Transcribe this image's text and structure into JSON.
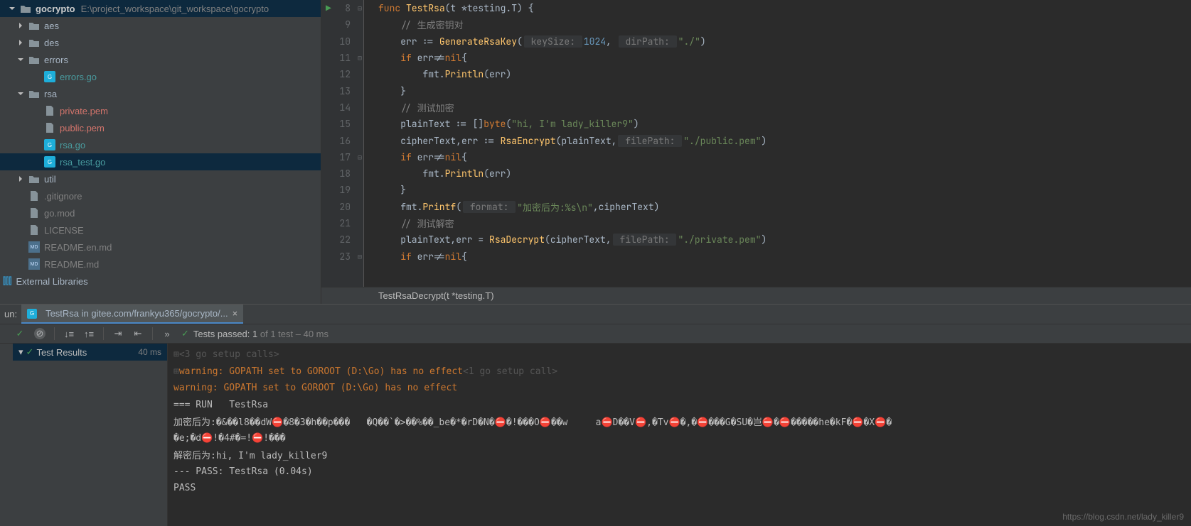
{
  "project": {
    "name": "gocrypto",
    "path": "E:\\project_workspace\\git_workspace\\gocrypto",
    "tree": [
      {
        "label": "aes",
        "type": "folder",
        "indent": 1,
        "arrow": "right"
      },
      {
        "label": "des",
        "type": "folder",
        "indent": 1,
        "arrow": "right"
      },
      {
        "label": "errors",
        "type": "folder",
        "indent": 1,
        "arrow": "down"
      },
      {
        "label": "errors.go",
        "type": "go",
        "indent": 2,
        "color": "teal"
      },
      {
        "label": "rsa",
        "type": "folder",
        "indent": 1,
        "arrow": "down"
      },
      {
        "label": "private.pem",
        "type": "file",
        "indent": 2,
        "color": "red"
      },
      {
        "label": "public.pem",
        "type": "file",
        "indent": 2,
        "color": "red"
      },
      {
        "label": "rsa.go",
        "type": "go",
        "indent": 2,
        "color": "teal"
      },
      {
        "label": "rsa_test.go",
        "type": "go",
        "indent": 2,
        "color": "teal",
        "selected": true
      },
      {
        "label": "util",
        "type": "folder",
        "indent": 1,
        "arrow": "right"
      },
      {
        "label": ".gitignore",
        "type": "file",
        "indent": 1,
        "color": "gray"
      },
      {
        "label": "go.mod",
        "type": "file",
        "indent": 1,
        "color": "gray"
      },
      {
        "label": "LICENSE",
        "type": "file",
        "indent": 1,
        "color": "gray"
      },
      {
        "label": "README.en.md",
        "type": "md",
        "indent": 1,
        "color": "gray"
      },
      {
        "label": "README.md",
        "type": "md",
        "indent": 1,
        "color": "gray"
      }
    ],
    "external_libraries": "External Libraries"
  },
  "editor": {
    "breadcrumb": "TestRsaDecrypt(t *testing.T)",
    "lines": [
      {
        "n": 8,
        "run": true,
        "fold": "open",
        "tokens": [
          [
            "kw",
            "func "
          ],
          [
            "fn",
            "TestRsa"
          ],
          [
            "ident",
            "(t *testing.T) {"
          ]
        ]
      },
      {
        "n": 9,
        "tokens": [
          [
            "ident",
            "    "
          ],
          [
            "cmt",
            "// 生成密钥对"
          ]
        ]
      },
      {
        "n": 10,
        "tokens": [
          [
            "ident",
            "    err := "
          ],
          [
            "fn",
            "GenerateRsaKey"
          ],
          [
            "ident",
            "("
          ],
          [
            "hint",
            " keySize: "
          ],
          [
            "num",
            "1024"
          ],
          [
            "ident",
            ", "
          ],
          [
            "hint",
            " dirPath: "
          ],
          [
            "str",
            "\"./\""
          ],
          [
            "ident",
            ")"
          ]
        ]
      },
      {
        "n": 11,
        "fold": "close",
        "tokens": [
          [
            "ident",
            "    "
          ],
          [
            "kw",
            "if "
          ],
          [
            "ident",
            "err!="
          ],
          [
            "kw",
            "nil"
          ],
          [
            "ident",
            "{"
          ]
        ]
      },
      {
        "n": 12,
        "tokens": [
          [
            "ident",
            "        fmt."
          ],
          [
            "fn",
            "Println"
          ],
          [
            "ident",
            "(err)"
          ]
        ]
      },
      {
        "n": 13,
        "tokens": [
          [
            "ident",
            "    }"
          ]
        ]
      },
      {
        "n": 14,
        "tokens": [
          [
            "ident",
            "    "
          ],
          [
            "cmt",
            "// 测试加密"
          ]
        ]
      },
      {
        "n": 15,
        "tokens": [
          [
            "ident",
            "    plainText := []"
          ],
          [
            "typ",
            "byte"
          ],
          [
            "ident",
            "("
          ],
          [
            "str",
            "\"hi, I'm lady_killer9\""
          ],
          [
            "ident",
            ")"
          ]
        ]
      },
      {
        "n": 16,
        "tokens": [
          [
            "ident",
            "    cipherText,err := "
          ],
          [
            "fn",
            "RsaEncrypt"
          ],
          [
            "ident",
            "(plainText,"
          ],
          [
            "hint",
            " filePath: "
          ],
          [
            "str",
            "\"./public.pem\""
          ],
          [
            "ident",
            ")"
          ]
        ]
      },
      {
        "n": 17,
        "fold": "close",
        "tokens": [
          [
            "ident",
            "    "
          ],
          [
            "kw",
            "if "
          ],
          [
            "ident",
            "err!="
          ],
          [
            "kw",
            "nil"
          ],
          [
            "ident",
            "{"
          ]
        ]
      },
      {
        "n": 18,
        "tokens": [
          [
            "ident",
            "        fmt."
          ],
          [
            "fn",
            "Println"
          ],
          [
            "ident",
            "(err)"
          ]
        ]
      },
      {
        "n": 19,
        "tokens": [
          [
            "ident",
            "    }"
          ]
        ]
      },
      {
        "n": 20,
        "tokens": [
          [
            "ident",
            "    fmt."
          ],
          [
            "fn",
            "Printf"
          ],
          [
            "ident",
            "("
          ],
          [
            "hint",
            " format: "
          ],
          [
            "str",
            "\"加密后为:%s\\n\""
          ],
          [
            "ident",
            ",cipherText)"
          ]
        ]
      },
      {
        "n": 21,
        "tokens": [
          [
            "ident",
            "    "
          ],
          [
            "cmt",
            "// 测试解密"
          ]
        ]
      },
      {
        "n": 22,
        "tokens": [
          [
            "ident",
            "    plainText,err = "
          ],
          [
            "fn",
            "RsaDecrypt"
          ],
          [
            "ident",
            "(cipherText,"
          ],
          [
            "hint",
            " filePath: "
          ],
          [
            "str",
            "\"./private.pem\""
          ],
          [
            "ident",
            ")"
          ]
        ]
      },
      {
        "n": 23,
        "fold": "close",
        "tokens": [
          [
            "ident",
            "    "
          ],
          [
            "kw",
            "if "
          ],
          [
            "ident",
            "err!="
          ],
          [
            "kw",
            "nil"
          ],
          [
            "ident",
            "{"
          ]
        ]
      }
    ]
  },
  "run": {
    "panel_label": "un:",
    "tab_title": "TestRsa in gitee.com/frankyu365/gocrypto/...",
    "tests_passed_prefix": "Tests passed:",
    "tests_passed_count": "1",
    "tests_passed_total": "of 1 test – 40 ms",
    "test_results_label": "Test Results",
    "test_results_time": "40 ms",
    "console": [
      {
        "cls": "console-gray",
        "prefix": "⊞",
        "text": "<3 go setup calls>"
      },
      {
        "cls": "console-orange",
        "prefix": "⊞",
        "text": "warning: GOPATH set to GOROOT (D:\\Go) has no effect",
        "suffix": "<1 go setup call>"
      },
      {
        "cls": "console-orange",
        "text": "warning: GOPATH set to GOROOT (D:\\Go) has no effect"
      },
      {
        "cls": "console-white",
        "text": "=== RUN   TestRsa"
      },
      {
        "cls": "console-white",
        "text": "加密后为:�&��l8��dW⛔�8�3�h��p���   �Q��`�>��%��_be�*�rD�N�⛔�!���O⛔��w     a⛔D��V⛔,�Tv⛔�,�⛔���G�SU�岂⛔�⛔�����he�kF�⛔�X⛔�"
      },
      {
        "cls": "console-white",
        "text": "�e;�d⛔!�4#�=!⛔!���"
      },
      {
        "cls": "console-white",
        "text": "解密后为:hi, I'm lady_killer9"
      },
      {
        "cls": "console-white",
        "text": "--- PASS: TestRsa (0.04s)"
      },
      {
        "cls": "console-white",
        "text": "PASS"
      }
    ]
  },
  "watermark": "https://blog.csdn.net/lady_killer9"
}
